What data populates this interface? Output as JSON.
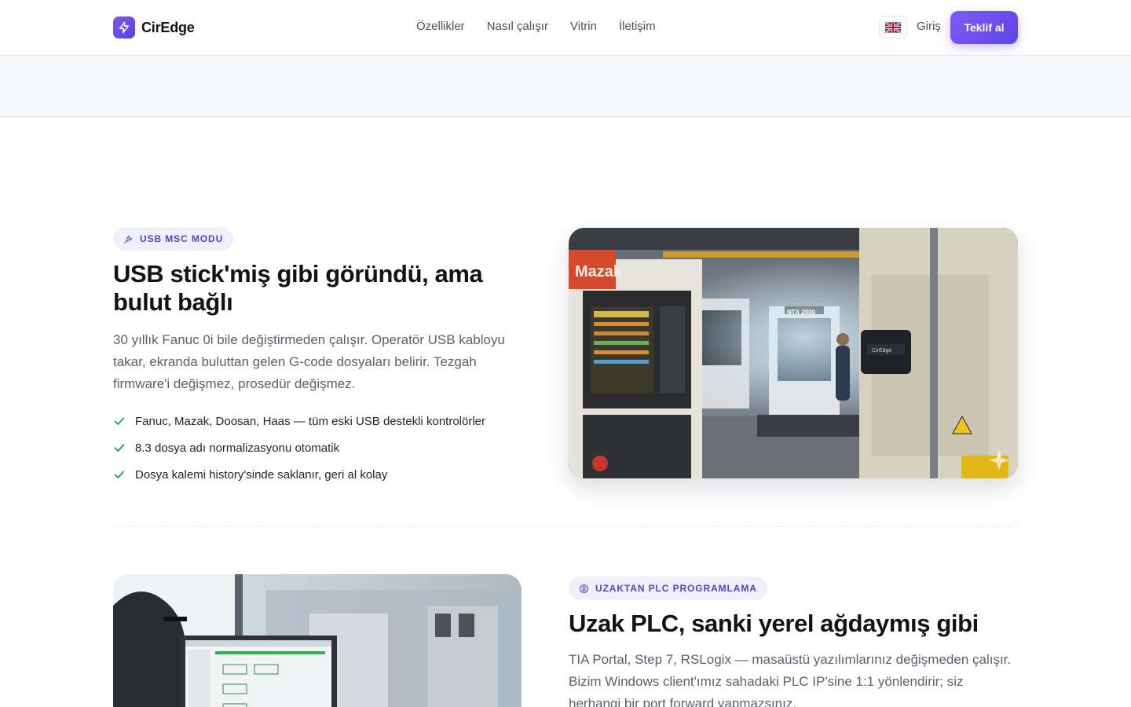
{
  "brand": {
    "name": "CirEdge",
    "accent": "#6b4ff0"
  },
  "nav": {
    "items": [
      "Özellikler",
      "Nasıl çalışır",
      "Vitrin",
      "İletişim"
    ],
    "login": "Giriş",
    "cta": "Teklif al",
    "language_icon": "uk-flag-icon"
  },
  "feature1": {
    "badge": "USB MSC MODU",
    "badge_icon": "plug-icon",
    "title": "USB stick'miş gibi göründü, ama bulut bağlı",
    "description": "30 yıllık Fanuc 0i bile değiştirmeden çalışır. Operatör USB kabloyu takar, ekranda buluttan gelen G-code dosyaları belirir. Tezgah firmware'i değişmez, prosedür değişmez.",
    "bullets": [
      "Fanuc, Mazak, Doosan, Haas — tüm eski USB destekli kontrolörler",
      "8.3 dosya adı normalizasyonu otomatik",
      "Dosya kalemi history'sinde saklanır, geri al kolay"
    ],
    "image_labels": [
      "Mazak",
      "NTX 2000",
      "CirEdge"
    ]
  },
  "feature2": {
    "badge": "UZAKTAN PLC PROGRAMLAMA",
    "badge_icon": "network-icon",
    "title": "Uzak PLC, sanki yerel ağdaymış gibi",
    "description": "TIA Portal, Step 7, RSLogix — masaüstü yazılımlarınız değişmeden çalışır. Bizim Windows client'ımız sahadaki PLC IP'sine 1:1 yönlendirir; siz herhangi bir port forward yapmazsınız."
  }
}
